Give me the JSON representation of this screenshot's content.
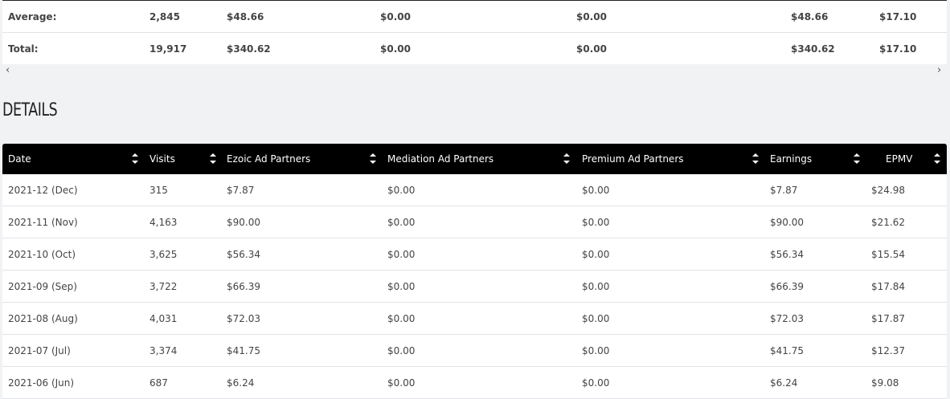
{
  "summary": {
    "rows": [
      {
        "label": "Average:",
        "visits": "2,845",
        "ezoic": "$48.66",
        "mediation": "$0.00",
        "premium": "$0.00",
        "earnings": "$48.66",
        "epmv": "$17.10"
      },
      {
        "label": "Total:",
        "visits": "19,917",
        "ezoic": "$340.62",
        "mediation": "$0.00",
        "premium": "$0.00",
        "earnings": "$340.62",
        "epmv": "$17.10"
      }
    ]
  },
  "scrollbar": {
    "left_icon": "chevron-left-icon",
    "right_icon": "chevron-right-icon",
    "left_glyph": "‹",
    "right_glyph": "›"
  },
  "details": {
    "title": "DETAILS",
    "columns": [
      "Date",
      "Visits",
      "Ezoic Ad Partners",
      "Mediation Ad Partners",
      "Premium Ad Partners",
      "Earnings",
      "EPMV"
    ],
    "rows": [
      [
        "2021-12 (Dec)",
        "315",
        "$7.87",
        "$0.00",
        "$0.00",
        "$7.87",
        "$24.98"
      ],
      [
        "2021-11 (Nov)",
        "4,163",
        "$90.00",
        "$0.00",
        "$0.00",
        "$90.00",
        "$21.62"
      ],
      [
        "2021-10 (Oct)",
        "3,625",
        "$56.34",
        "$0.00",
        "$0.00",
        "$56.34",
        "$15.54"
      ],
      [
        "2021-09 (Sep)",
        "3,722",
        "$66.39",
        "$0.00",
        "$0.00",
        "$66.39",
        "$17.84"
      ],
      [
        "2021-08 (Aug)",
        "4,031",
        "$72.03",
        "$0.00",
        "$0.00",
        "$72.03",
        "$17.87"
      ],
      [
        "2021-07 (Jul)",
        "3,374",
        "$41.75",
        "$0.00",
        "$0.00",
        "$41.75",
        "$12.37"
      ],
      [
        "2021-06 (Jun)",
        "687",
        "$6.24",
        "$0.00",
        "$0.00",
        "$6.24",
        "$9.08"
      ]
    ]
  },
  "colors": {
    "header_bg": "#000000",
    "page_bg": "#f1f2f4",
    "row_bg": "#ffffff",
    "border": "#e2e3e6"
  }
}
